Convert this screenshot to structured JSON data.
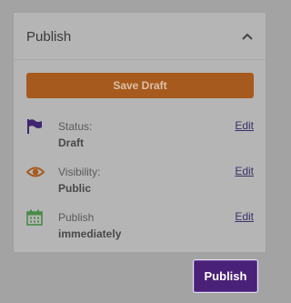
{
  "panel": {
    "title": "Publish",
    "save_draft_label": "Save Draft",
    "rows": [
      {
        "label": "Status:",
        "value": "Draft",
        "edit_label": "Edit",
        "icon": "flag-icon",
        "icon_color": "#3e2670"
      },
      {
        "label": "Visibility:",
        "value": "Public",
        "edit_label": "Edit",
        "icon": "eye-icon",
        "icon_color": "#a65a1e"
      },
      {
        "label": "Publish",
        "value": "immediately",
        "edit_label": "Edit",
        "icon": "calendar-icon",
        "icon_color": "#4a8a4a"
      }
    ]
  },
  "publish_button_label": "Publish",
  "colors": {
    "accent_orange": "#a65a1e",
    "accent_purple": "#4a2178",
    "background": "#a3a3a3",
    "panel": "#b5b5b5"
  }
}
